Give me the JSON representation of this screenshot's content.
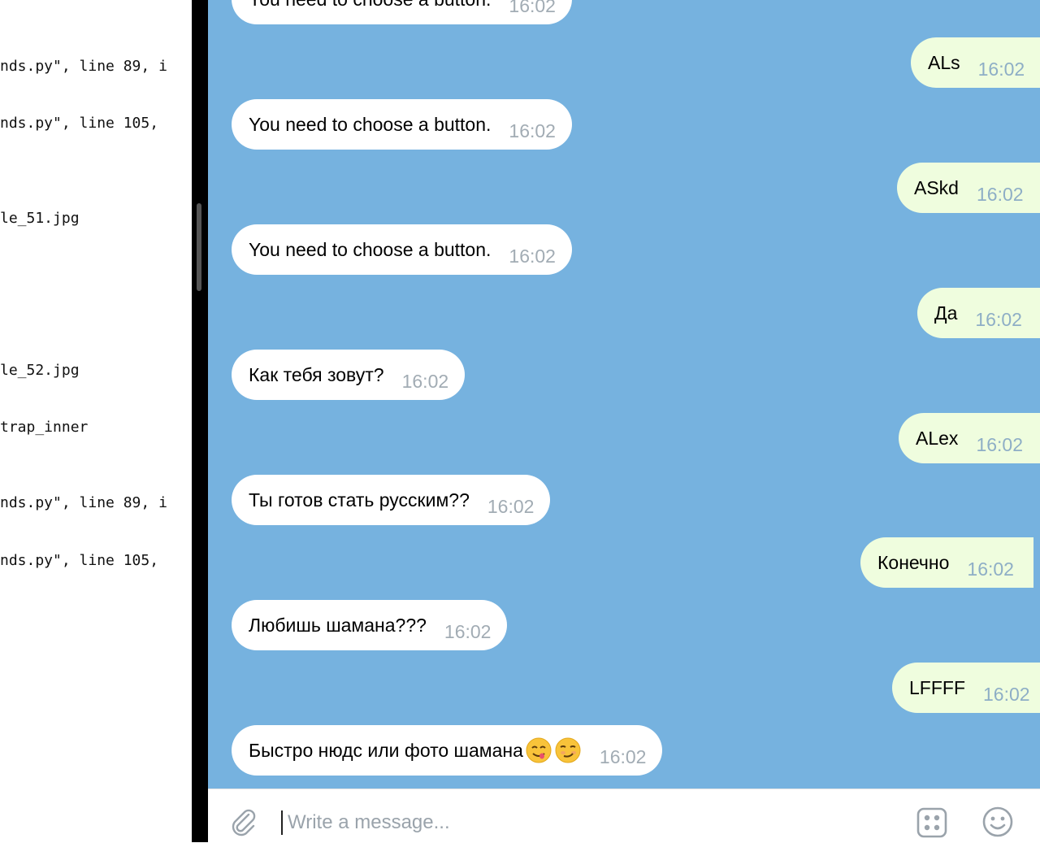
{
  "terminal": {
    "lines": [
      "nds.py\", line 89, i",
      "nds.py\", line 105,",
      "le_51.jpg",
      "le_52.jpg",
      "trap_inner",
      "nds.py\", line 89, i",
      "nds.py\", line 105,"
    ]
  },
  "chat": {
    "messages": [
      {
        "dir": "in",
        "text": "You need to choose a button.",
        "time": "16:02"
      },
      {
        "dir": "out",
        "text": "ALs",
        "time": "16:02"
      },
      {
        "dir": "in",
        "text": "You need to choose a button.",
        "time": "16:02"
      },
      {
        "dir": "out",
        "text": "ASkd",
        "time": "16:02"
      },
      {
        "dir": "in",
        "text": "You need to choose a button.",
        "time": "16:02"
      },
      {
        "dir": "out",
        "text": "Да",
        "time": "16:02"
      },
      {
        "dir": "in",
        "text": "Как тебя зовут?",
        "time": "16:02"
      },
      {
        "dir": "out",
        "text": "ALex",
        "time": "16:02"
      },
      {
        "dir": "in",
        "text": "Ты готов стать русским??",
        "time": "16:02"
      },
      {
        "dir": "out",
        "text": "Конечно",
        "time": "16:02"
      },
      {
        "dir": "in",
        "text": "Любишь шамана???",
        "time": "16:02"
      },
      {
        "dir": "out",
        "text": "LFFFF",
        "time": "16:02"
      },
      {
        "dir": "in",
        "text": "Быстро нюдс или фото шамана",
        "time": "16:02",
        "emojis": [
          "yum-face-icon",
          "smirk-face-icon"
        ]
      }
    ]
  },
  "composer": {
    "placeholder": "Write a message...",
    "value": ""
  },
  "colors": {
    "chat_background": "#76b2df",
    "incoming_bubble": "#ffffff",
    "outgoing_bubble": "#effdde",
    "timestamp": "#a2acb4"
  }
}
